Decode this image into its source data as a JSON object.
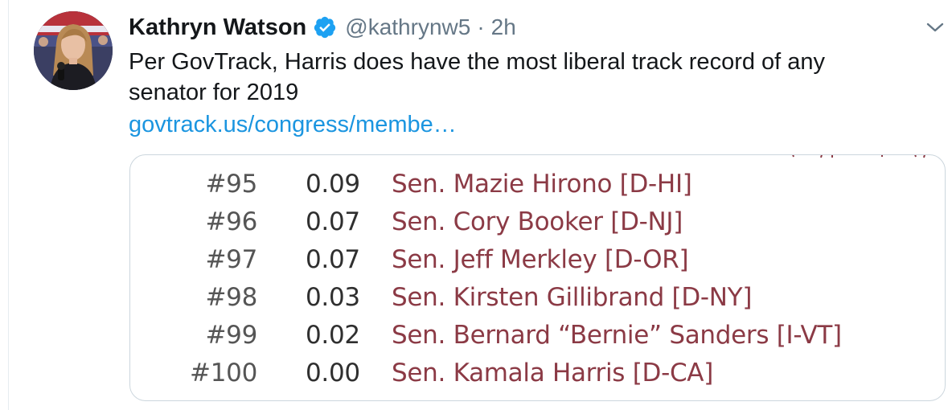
{
  "tweet": {
    "author_name": "Kathryn Watson",
    "handle": "@kathrynw5",
    "separator": "·",
    "time": "2h",
    "text": "Per GovTrack, Harris does have the most liberal track record of any senator for 2019",
    "link_text": "govtrack.us/congress/membe…",
    "verified": true
  },
  "card": {
    "rows": [
      {
        "rank": "#95",
        "score": "0.09",
        "senator": "Sen. Mazie Hirono [D-HI]"
      },
      {
        "rank": "#96",
        "score": "0.07",
        "senator": "Sen. Cory Booker [D-NJ]"
      },
      {
        "rank": "#97",
        "score": "0.07",
        "senator": "Sen. Jeff Merkley [D-OR]"
      },
      {
        "rank": "#98",
        "score": "0.03",
        "senator": "Sen. Kirsten Gillibrand [D-NY]"
      },
      {
        "rank": "#99",
        "score": "0.02",
        "senator": "Sen. Bernard “Bernie” Sanders [I-VT]"
      },
      {
        "rank": "#100",
        "score": "0.00",
        "senator": "Sen. Kamala Harris [D-CA]"
      }
    ]
  },
  "colors": {
    "link": "#1b95e0",
    "verified_badge": "#1da1f2",
    "senator_name": "#8b3a45",
    "secondary_text": "#657786"
  },
  "icons": {
    "verified": "verified-badge-icon",
    "more": "chevron-down-icon"
  }
}
